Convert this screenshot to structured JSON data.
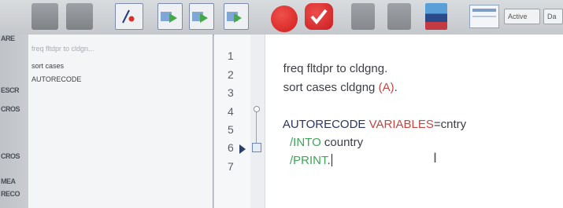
{
  "toolbar": {
    "mode_label": "Active",
    "dataset_label": "Da",
    "icons": [
      "grid-icon",
      "grid-icon",
      "chart-icon",
      "run-selection-icon",
      "run-to-end-icon",
      "run-all-icon",
      "breakpoint-icon",
      "check-icon",
      "copy-icon",
      "bookmark-icon",
      "chart-builder-icon",
      "panel-icon"
    ]
  },
  "left_strip": {
    "labels": [
      "ARE",
      "ESCR",
      "CROS",
      "CROS",
      "MEA",
      "RECO"
    ]
  },
  "navigation": {
    "items": [
      "freq fltdpr to cldgn...",
      "sort cases",
      "AUTORECODE"
    ]
  },
  "editor": {
    "line_numbers": [
      "1",
      "2",
      "3",
      "4",
      "5",
      "6",
      "7"
    ],
    "lines": [
      {
        "parts": [
          {
            "text": "freq fltdpr to cldgng.",
            "style": "text"
          }
        ]
      },
      {
        "parts": [
          {
            "text": "sort cases cldgng ",
            "style": "text"
          },
          {
            "text": "(A)",
            "style": "kw"
          },
          {
            "text": ".",
            "style": "text"
          }
        ]
      },
      {
        "parts": []
      },
      {
        "parts": [
          {
            "text": "AUTORECODE ",
            "style": "cmd"
          },
          {
            "text": "VARIABLES",
            "style": "kw"
          },
          {
            "text": "=cntry",
            "style": "text"
          }
        ]
      },
      {
        "parts": [
          {
            "text": "  /INTO ",
            "style": "sub"
          },
          {
            "text": "country",
            "style": "text"
          }
        ]
      },
      {
        "parts": [
          {
            "text": "  /PRINT",
            "style": "sub"
          },
          {
            "text": ".",
            "style": "text"
          }
        ]
      },
      {
        "parts": []
      }
    ]
  },
  "colors": {
    "command": "#2a3564",
    "keyword": "#c24742",
    "subcommand": "#3ea55a",
    "text": "#3b3f47"
  }
}
